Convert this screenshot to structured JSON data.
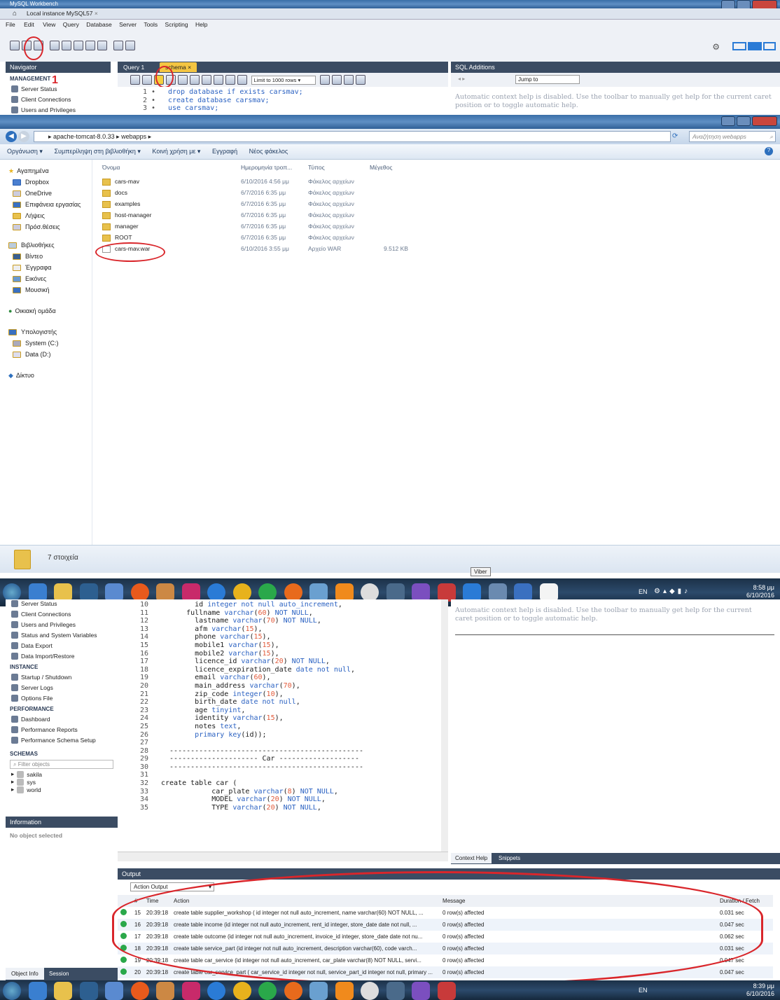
{
  "wb_top": {
    "title": "MySQL Workbench",
    "tab": "Local instance MySQL57",
    "menu": [
      "File",
      "Edit",
      "View",
      "Query",
      "Database",
      "Server",
      "Tools",
      "Scripting",
      "Help"
    ],
    "nav_title": "Navigator",
    "management": "MANAGEMENT",
    "mgmt_items": [
      "Server Status",
      "Client Connections",
      "Users and Privileges"
    ],
    "query_tab1": "Query 1",
    "query_tab2": "schema",
    "limit": "Limit to 1000 rows",
    "sql_add": "SQL Additions",
    "jump": "Jump to",
    "help_text": "Automatic context help is disabled. Use the toolbar to manually get help for the current caret position or to toggle automatic help.",
    "annotation_1": "1",
    "code": [
      {
        "n": "1",
        "t": "drop database if exists carsmav;"
      },
      {
        "n": "2",
        "t": "create database carsmav;"
      },
      {
        "n": "3",
        "t": "use carsmav;"
      }
    ]
  },
  "explorer": {
    "path": [
      "apache-tomcat-8.0.33",
      "webapps"
    ],
    "search": "Αναζήτηση webapps",
    "toolbar": [
      "Οργάνωση ▾",
      "Συμπερίληψη στη βιβλιοθήκη ▾",
      "Κοινή χρήση με ▾",
      "Εγγραφή",
      "Νέος φάκελος"
    ],
    "cols": [
      "Όνομα",
      "Ημερομηνία τροπ...",
      "Τύπος",
      "Μέγεθος"
    ],
    "nav": [
      "Αγαπημένα",
      "Dropbox",
      "OneDrive",
      "Επιφάνεια εργασίας",
      "Λήψεις",
      "Πρόσ.θέσεις",
      "",
      "Βιβλιοθήκες",
      "Βίντεο",
      "Έγγραφα",
      "Εικόνες",
      "Μουσική",
      "",
      "Οικιακή ομάδα",
      "",
      "Υπολογιστής",
      "System (C:)",
      "Data (D:)",
      "",
      "Δίκτυο"
    ],
    "files": [
      {
        "name": "cars-mav",
        "date": "6/10/2016 4:56 μμ",
        "type": "Φάκελος αρχείων",
        "size": ""
      },
      {
        "name": "docs",
        "date": "6/7/2016 6:35 μμ",
        "type": "Φάκελος αρχείων",
        "size": ""
      },
      {
        "name": "examples",
        "date": "6/7/2016 6:35 μμ",
        "type": "Φάκελος αρχείων",
        "size": ""
      },
      {
        "name": "host-manager",
        "date": "6/7/2016 6:35 μμ",
        "type": "Φάκελος αρχείων",
        "size": ""
      },
      {
        "name": "manager",
        "date": "6/7/2016 6:35 μμ",
        "type": "Φάκελος αρχείων",
        "size": ""
      },
      {
        "name": "ROOT",
        "date": "6/7/2016 6:35 μμ",
        "type": "Φάκελος αρχείων",
        "size": ""
      },
      {
        "name": "cars-mav.war",
        "date": "6/10/2016 3:55 μμ",
        "type": "Αρχείο WAR",
        "size": "9.512 KB"
      }
    ],
    "status": "7 στοιχεία"
  },
  "taskbar1": {
    "tooltip": "Viber",
    "lang": "EN",
    "time": "8:58 μμ",
    "date": "6/10/2016"
  },
  "wb_bottom": {
    "mgmt_items": [
      "Server Status",
      "Client Connections",
      "Users and Privileges",
      "Status and System Variables",
      "Data Export",
      "Data Import/Restore"
    ],
    "instance": "INSTANCE",
    "inst_items": [
      "Startup / Shutdown",
      "Server Logs",
      "Options File"
    ],
    "performance": "PERFORMANCE",
    "perf_items": [
      "Dashboard",
      "Performance Reports",
      "Performance Schema Setup"
    ],
    "schemas": "SCHEMAS",
    "filter": "Filter objects",
    "schema_list": [
      "sakila",
      "sys",
      "world"
    ],
    "info": "Information",
    "no_obj": "No object selected",
    "tab_obj": "Object Info",
    "tab_sess": "Session",
    "help_text": "Automatic context help is disabled. Use the toolbar to manually get help for the current caret position or to toggle automatic help.",
    "ctx_tab": "Context Help",
    "snip_tab": "Snippets",
    "code": [
      {
        "n": "10",
        "h": "        id integer not null auto_increment,"
      },
      {
        "n": "11",
        "h": "      fullname varchar(60) NOT NULL,"
      },
      {
        "n": "12",
        "h": "        lastname varchar(70) NOT NULL,"
      },
      {
        "n": "13",
        "h": "        afm varchar(15),"
      },
      {
        "n": "14",
        "h": "        phone varchar(15),"
      },
      {
        "n": "15",
        "h": "        mobile1 varchar(15),"
      },
      {
        "n": "16",
        "h": "        mobile2 varchar(15),"
      },
      {
        "n": "17",
        "h": "        licence_id varchar(20) NOT NULL,"
      },
      {
        "n": "18",
        "h": "        licence_expiration_date date not null,"
      },
      {
        "n": "19",
        "h": "        email varchar(60),"
      },
      {
        "n": "20",
        "h": "        main_address varchar(70),"
      },
      {
        "n": "21",
        "h": "        zip_code integer(10),"
      },
      {
        "n": "22",
        "h": "        birth_date date not null,"
      },
      {
        "n": "23",
        "h": "        age tinyint,"
      },
      {
        "n": "24",
        "h": "        identity varchar(15),"
      },
      {
        "n": "25",
        "h": "        notes text,"
      },
      {
        "n": "26",
        "h": "        primary key(id));"
      },
      {
        "n": "27",
        "h": ""
      },
      {
        "n": "28",
        "h": "  ----------------------------------------------"
      },
      {
        "n": "29",
        "h": "  --------------------- Car -------------------"
      },
      {
        "n": "30",
        "h": "  ----------------------------------------------"
      },
      {
        "n": "31",
        "h": ""
      },
      {
        "n": "32",
        "h": "create table car ("
      },
      {
        "n": "33",
        "h": "            car_plate varchar(8) NOT NULL,"
      },
      {
        "n": "34",
        "h": "            MODEL varchar(20) NOT NULL,"
      },
      {
        "n": "35",
        "h": "            TYPE varchar(20) NOT NULL,"
      }
    ],
    "output": "Output",
    "action_output": "Action Output",
    "out_cols": [
      "#",
      "Time",
      "Action",
      "Message",
      "Duration / Fetch"
    ],
    "rows": [
      {
        "n": "15",
        "time": "20:39:18",
        "action": "create table supplier_workshop ( id integer not null auto_increment,   name varchar(60) NOT NULL,  ...",
        "msg": "0 row(s) affected",
        "dur": "0.031 sec"
      },
      {
        "n": "16",
        "time": "20:39:18",
        "action": "create table income (id integer not null auto_increment,   rent_id integer, store_date date not null,   ...",
        "msg": "0 row(s) affected",
        "dur": "0.047 sec"
      },
      {
        "n": "17",
        "time": "20:39:18",
        "action": "create table outcome (id integer not null auto_increment,   invoice_id integer, store_date date not nu...",
        "msg": "0 row(s) affected",
        "dur": "0.062 sec"
      },
      {
        "n": "18",
        "time": "20:39:18",
        "action": "create table service_part (id integer not null auto_increment,   description varchar(60),   code varch...",
        "msg": "0 row(s) affected",
        "dur": "0.031 sec"
      },
      {
        "n": "19",
        "time": "20:39:18",
        "action": "create table car_service (id integer not null auto_increment, car_plate varchar(8) NOT NULL,   servi...",
        "msg": "0 row(s) affected",
        "dur": "0.047 sec"
      },
      {
        "n": "20",
        "time": "20:39:18",
        "action": "create table car_service_part ( car_service_id integer not null, service_part_id integer not null, primary ...",
        "msg": "0 row(s) affected",
        "dur": "0.047 sec"
      }
    ]
  },
  "taskbar2": {
    "lang": "EN",
    "time": "8:39 μμ",
    "date": "6/10/2016"
  }
}
